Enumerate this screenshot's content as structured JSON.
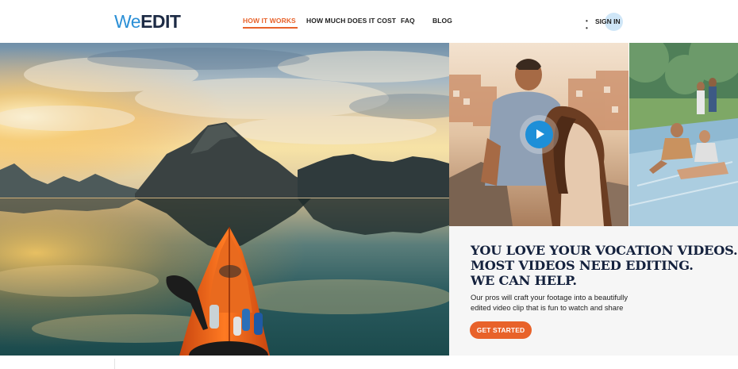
{
  "logo": {
    "part_we": "We",
    "part_edit": "EDIT"
  },
  "nav": {
    "items": [
      {
        "label": "HOW IT WORKS",
        "active": true
      },
      {
        "label": "HOW MUCH DOES IT COST",
        "active": false
      },
      {
        "label": "FAQ",
        "active": false
      },
      {
        "label": "BLOG",
        "active": false
      }
    ],
    "signin": {
      "dots": "• •",
      "label": "SIGN IN"
    }
  },
  "promo": {
    "headline": [
      "YOU LOVE YOUR VOCATION VIDEOS.",
      "MOST VIDEOS NEED EDITING.",
      "WE CAN HELP."
    ],
    "subtext_line1": "Our pros will craft your footage into a beautifully",
    "subtext_line2": "edited video clip that is fun to watch and share",
    "cta_label": "GET STARTED"
  },
  "colors": {
    "accent": "#e8622a",
    "brand_blue": "#2a8fd6",
    "brand_navy": "#1d2b45",
    "play_blue": "#1e8fd8"
  },
  "icons": {
    "play": "play-icon"
  }
}
